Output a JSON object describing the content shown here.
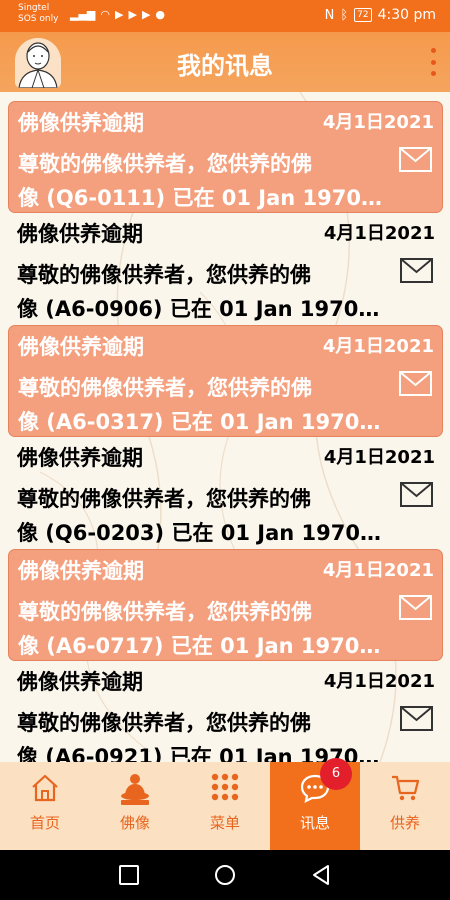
{
  "statusbar": {
    "carrier_line1": "Singtel",
    "carrier_line2": "SOS only",
    "battery": "72",
    "time": "4:30 pm"
  },
  "header": {
    "title": "我的讯息"
  },
  "messages": [
    {
      "title": "佛像供养逾期",
      "date": "4月1日2021",
      "line1": "尊敬的佛像供养者，您供养的佛",
      "line2": "像 (Q6-0111) 已在 01 Jan 1970...",
      "unread": true
    },
    {
      "title": "佛像供养逾期",
      "date": "4月1日2021",
      "line1": "尊敬的佛像供养者，您供养的佛",
      "line2": "像 (A6-0906) 已在 01 Jan 1970...",
      "unread": false
    },
    {
      "title": "佛像供养逾期",
      "date": "4月1日2021",
      "line1": "尊敬的佛像供养者，您供养的佛",
      "line2": "像 (A6-0317) 已在 01 Jan 1970...",
      "unread": true
    },
    {
      "title": "佛像供养逾期",
      "date": "4月1日2021",
      "line1": "尊敬的佛像供养者，您供养的佛",
      "line2": "像 (Q6-0203) 已在 01 Jan 1970...",
      "unread": false
    },
    {
      "title": "佛像供养逾期",
      "date": "4月1日2021",
      "line1": "尊敬的佛像供养者，您供养的佛",
      "line2": "像 (A6-0717) 已在 01 Jan 1970...",
      "unread": true
    },
    {
      "title": "佛像供养逾期",
      "date": "4月1日2021",
      "line1": "尊敬的佛像供养者，您供养的佛",
      "line2": "像 (A6-0921) 已在 01 Jan 1970...",
      "unread": false
    }
  ],
  "nav": {
    "items": [
      {
        "label": "首页",
        "icon": "home-icon"
      },
      {
        "label": "佛像",
        "icon": "buddha-icon"
      },
      {
        "label": "菜单",
        "icon": "grid-menu-icon"
      },
      {
        "label": "讯息",
        "icon": "chat-bubble-icon",
        "badge": "6",
        "active": true
      },
      {
        "label": "供养",
        "icon": "cart-icon"
      }
    ]
  },
  "colors": {
    "brand": "#f26f1b",
    "unread_bg": "#f4a07e",
    "nav_bg": "#fbe0c2",
    "badge": "#e41f2c"
  }
}
